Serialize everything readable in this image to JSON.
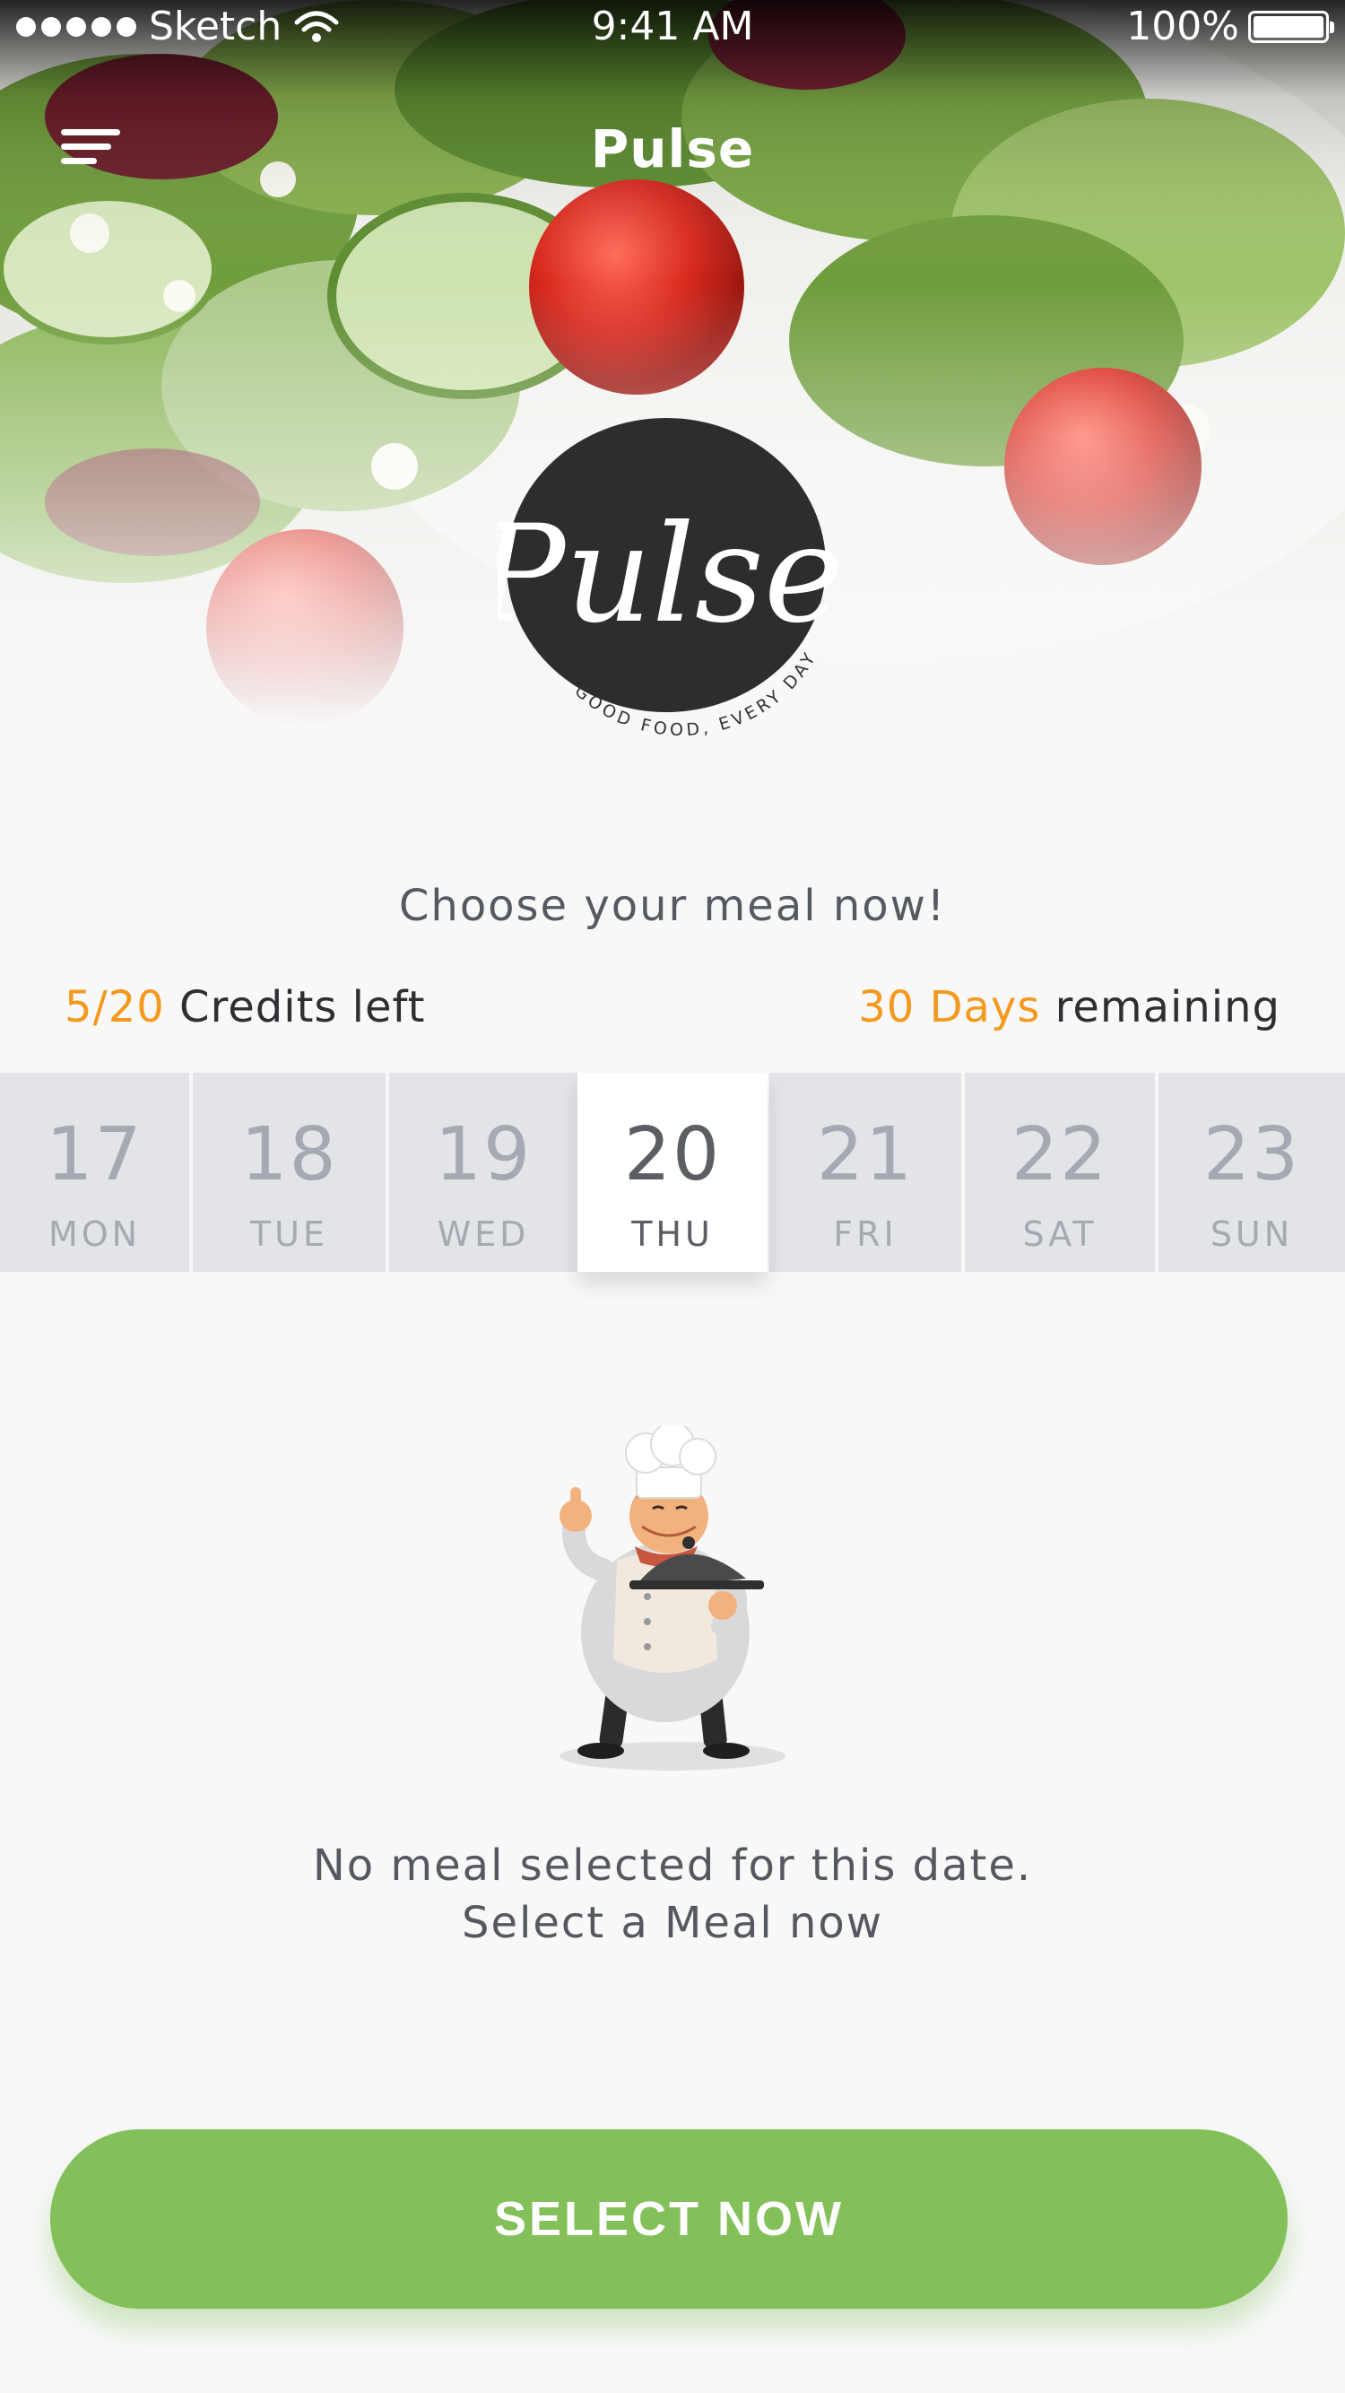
{
  "status_bar": {
    "carrier": "Sketch",
    "time": "9:41 AM",
    "battery": "100%"
  },
  "nav": {
    "title": "Pulse"
  },
  "logo": {
    "wordmark": "Pulse",
    "tagline": "GOOD FOOD, EVERY DAY"
  },
  "main": {
    "prompt": "Choose your meal now!",
    "credits_value": "5/20",
    "credits_label": " Credits left",
    "days_value": "30 Days",
    "days_label": " remaining"
  },
  "dates": [
    {
      "num": "17",
      "dow": "MON",
      "active": false
    },
    {
      "num": "18",
      "dow": "TUE",
      "active": false
    },
    {
      "num": "19",
      "dow": "WED",
      "active": false
    },
    {
      "num": "20",
      "dow": "THU",
      "active": true
    },
    {
      "num": "21",
      "dow": "FRI",
      "active": false
    },
    {
      "num": "22",
      "dow": "SAT",
      "active": false
    },
    {
      "num": "23",
      "dow": "SUN",
      "active": false
    }
  ],
  "empty_state": {
    "line1": "No meal selected for this date.",
    "line2": "Select a Meal now"
  },
  "cta": {
    "label": "SELECT NOW"
  },
  "colors": {
    "accent_orange": "#f39a1e",
    "button_green": "#84c05a",
    "logo_dark": "#2e2d2e"
  }
}
